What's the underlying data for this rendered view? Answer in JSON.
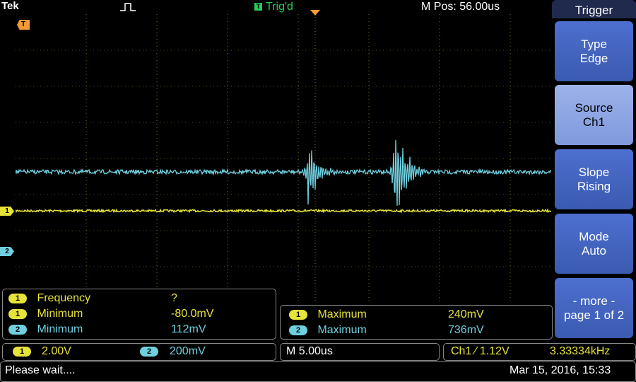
{
  "header": {
    "brand": "Tek",
    "trigger_state": "Trig'd",
    "trigger_state_badge": "T",
    "position": "M Pos: 56.00us"
  },
  "markers": {
    "ch1": "1",
    "ch2": "2",
    "trigger": "T"
  },
  "colors": {
    "ch1": "#e6e33a",
    "ch2": "#6fd0e0",
    "trigger": "#f19a37",
    "menu_button": "#4466c4",
    "status_green": "#22cc55"
  },
  "side_menu": {
    "title": "Trigger",
    "items": [
      {
        "line1": "Type",
        "line2": "Edge"
      },
      {
        "line1": "Source",
        "line2": "Ch1"
      },
      {
        "line1": "Slope",
        "line2": "Rising"
      },
      {
        "line1": "Mode",
        "line2": "Auto"
      },
      {
        "line1": "- more -",
        "line2": "page 1 of 2"
      }
    ]
  },
  "measurements_left": [
    {
      "channel": "1",
      "label": "Frequency",
      "value": "?"
    },
    {
      "channel": "1",
      "label": "Minimum",
      "value": "-80.0mV"
    },
    {
      "channel": "2",
      "label": "Minimum",
      "value": "112mV"
    }
  ],
  "measurements_right": [
    {
      "channel": "1",
      "label": "Maximum",
      "value": "240mV"
    },
    {
      "channel": "2",
      "label": "Maximum",
      "value": "736mV"
    }
  ],
  "readouts": {
    "ch1_badge": "1",
    "ch1_scale": "2.00V",
    "ch2_badge": "2",
    "ch2_scale": "200mV",
    "horizontal": "M 5.00us",
    "trigger": "Ch1 ∕ 1.12V",
    "trigger_freq": "3.33334kHz"
  },
  "status": {
    "message": "Please wait....",
    "datetime": "Mar 15, 2016, 15:33"
  }
}
